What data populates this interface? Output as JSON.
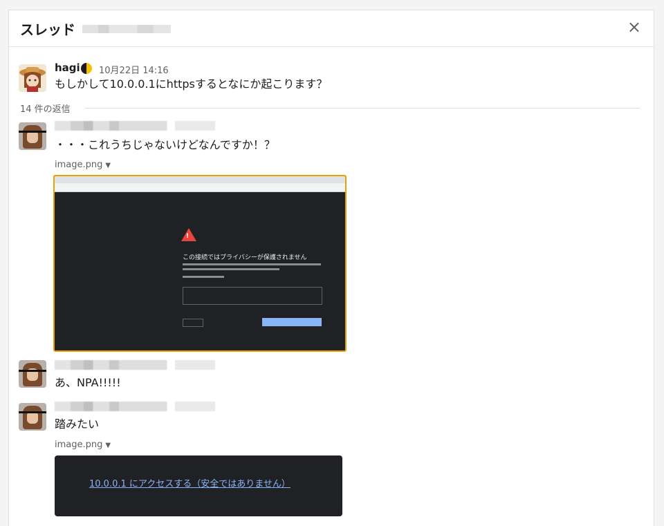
{
  "header": {
    "title": "スレッド",
    "close_icon": "×"
  },
  "parent": {
    "name": "hagi",
    "timestamp": "10月22日 14:16",
    "text": "もしかして10.0.0.1にhttpsするとなにか起こります？"
  },
  "replies_label": "14 件の返信",
  "replies": [
    {
      "text": "・・・これうちじゃないけどなんですか！？",
      "file": "image.png"
    },
    {
      "text": "あ、NPA!!!!!"
    },
    {
      "text": "踏みたい",
      "file": "image.png"
    }
  ],
  "image1": {
    "heading": "この接続ではプライバシーが保護されません"
  },
  "image2": {
    "link": "10.0.0.1 にアクセスする（安全ではありません）"
  }
}
